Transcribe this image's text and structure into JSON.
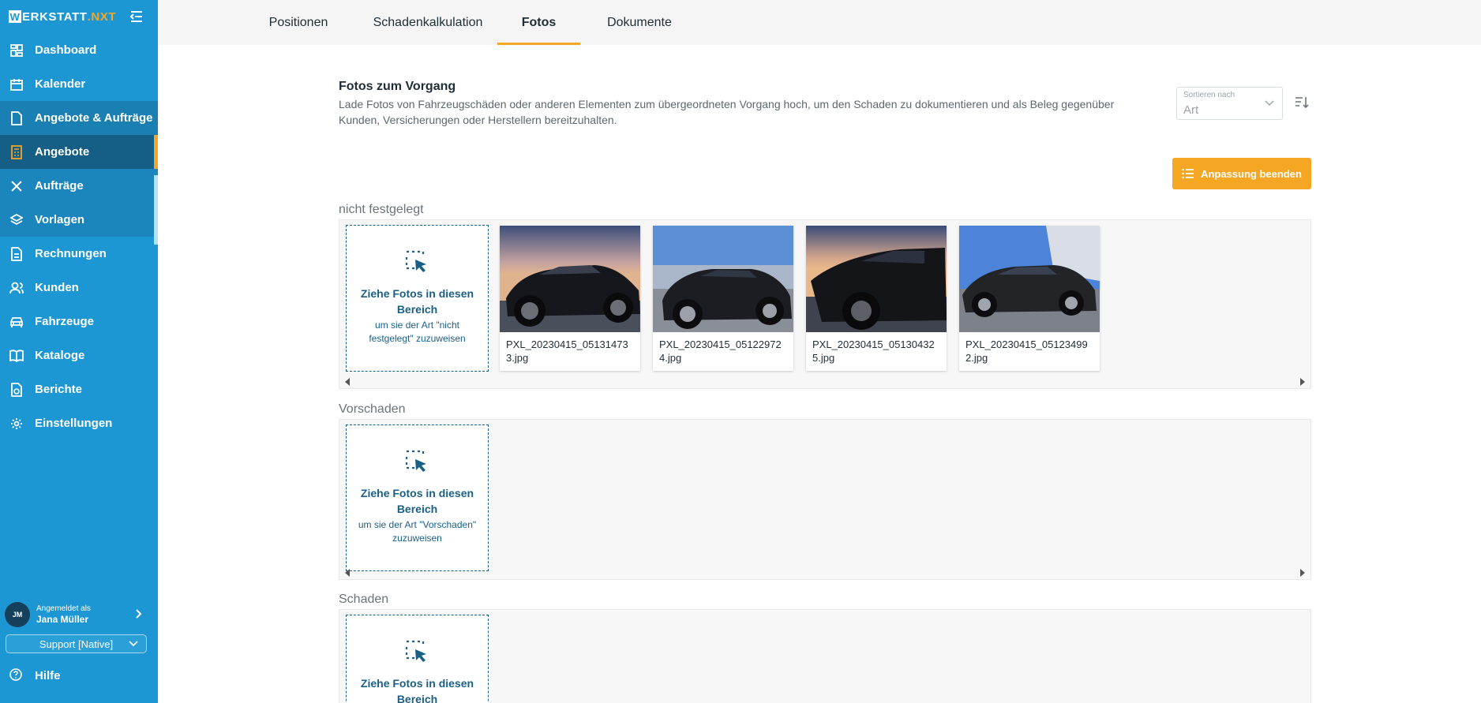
{
  "brand": {
    "prefix": "W",
    "main": "ERKSTATT",
    "suffix": ".NXT"
  },
  "sidebar": {
    "items": [
      {
        "label": "Dashboard",
        "icon": "dashboard-icon"
      },
      {
        "label": "Kalender",
        "icon": "calendar-icon"
      },
      {
        "label": "Angebote & Aufträge",
        "icon": "document-icon"
      },
      {
        "label": "Angebote",
        "icon": "calculator-icon"
      },
      {
        "label": "Aufträge",
        "icon": "tools-icon"
      },
      {
        "label": "Vorlagen",
        "icon": "layers-icon"
      },
      {
        "label": "Rechnungen",
        "icon": "invoice-icon"
      },
      {
        "label": "Kunden",
        "icon": "users-icon"
      },
      {
        "label": "Fahrzeuge",
        "icon": "car-icon"
      },
      {
        "label": "Kataloge",
        "icon": "book-icon"
      },
      {
        "label": "Berichte",
        "icon": "report-icon"
      },
      {
        "label": "Einstellungen",
        "icon": "gear-icon"
      }
    ],
    "user": {
      "initials": "JM",
      "caption": "Angemeldet als",
      "name": "Jana Müller"
    },
    "support_select": "Support [Native]",
    "help": "Hilfe"
  },
  "tabs": [
    {
      "label": "Positionen"
    },
    {
      "label": "Schadenkalkulation"
    },
    {
      "label": "Fotos",
      "active": true
    },
    {
      "label": "Dokumente"
    }
  ],
  "main": {
    "title": "Fotos zum Vorgang",
    "description": "Lade Fotos von Fahrzeugschäden oder anderen Elementen zum übergeordneten Vorgang hoch, um den Schaden zu dokumentieren und als Beleg gegenüber Kunden, Versicherungen oder Herstellern bereitzuhalten.",
    "sort": {
      "label": "Sortieren nach",
      "value": "Art"
    },
    "finish_button": "Anpassung beenden",
    "groups": [
      {
        "label": "nicht festgelegt",
        "drop_title": "Ziehe Fotos in diesen Bereich",
        "drop_sub": "um sie der Art \"nicht festgelegt\" zuzuweisen",
        "photos": [
          {
            "name": "PXL_20230415_051314733.jpg"
          },
          {
            "name": "PXL_20230415_051229724.jpg"
          },
          {
            "name": "PXL_20230415_051304325.jpg"
          },
          {
            "name": "PXL_20230415_051234992.jpg"
          }
        ]
      },
      {
        "label": "Vorschaden",
        "drop_title": "Ziehe Fotos in diesen Bereich",
        "drop_sub": "um sie der Art \"Vorschaden\" zuzuweisen",
        "photos": []
      },
      {
        "label": "Schaden",
        "drop_title": "Ziehe Fotos in diesen Bereich",
        "drop_sub": "",
        "photos": []
      }
    ]
  },
  "colors": {
    "sidebar": "#1d97d4",
    "accent": "#f5a623",
    "active_nav": "#155f86",
    "drop_border": "#1a5f86"
  }
}
